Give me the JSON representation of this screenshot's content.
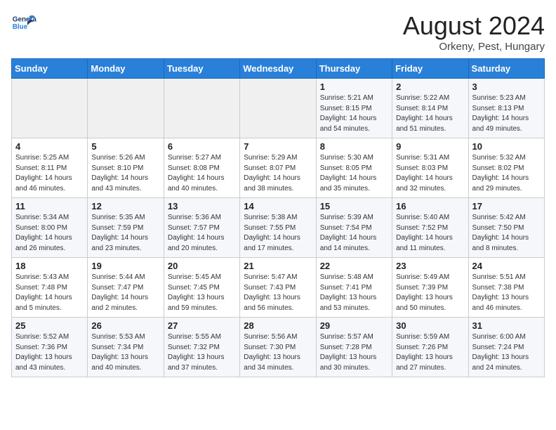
{
  "header": {
    "logo_line1": "General",
    "logo_line2": "Blue",
    "month": "August 2024",
    "location": "Orkeny, Pest, Hungary"
  },
  "days_of_week": [
    "Sunday",
    "Monday",
    "Tuesday",
    "Wednesday",
    "Thursday",
    "Friday",
    "Saturday"
  ],
  "weeks": [
    [
      {
        "day": "",
        "info": ""
      },
      {
        "day": "",
        "info": ""
      },
      {
        "day": "",
        "info": ""
      },
      {
        "day": "",
        "info": ""
      },
      {
        "day": "1",
        "info": "Sunrise: 5:21 AM\nSunset: 8:15 PM\nDaylight: 14 hours\nand 54 minutes."
      },
      {
        "day": "2",
        "info": "Sunrise: 5:22 AM\nSunset: 8:14 PM\nDaylight: 14 hours\nand 51 minutes."
      },
      {
        "day": "3",
        "info": "Sunrise: 5:23 AM\nSunset: 8:13 PM\nDaylight: 14 hours\nand 49 minutes."
      }
    ],
    [
      {
        "day": "4",
        "info": "Sunrise: 5:25 AM\nSunset: 8:11 PM\nDaylight: 14 hours\nand 46 minutes."
      },
      {
        "day": "5",
        "info": "Sunrise: 5:26 AM\nSunset: 8:10 PM\nDaylight: 14 hours\nand 43 minutes."
      },
      {
        "day": "6",
        "info": "Sunrise: 5:27 AM\nSunset: 8:08 PM\nDaylight: 14 hours\nand 40 minutes."
      },
      {
        "day": "7",
        "info": "Sunrise: 5:29 AM\nSunset: 8:07 PM\nDaylight: 14 hours\nand 38 minutes."
      },
      {
        "day": "8",
        "info": "Sunrise: 5:30 AM\nSunset: 8:05 PM\nDaylight: 14 hours\nand 35 minutes."
      },
      {
        "day": "9",
        "info": "Sunrise: 5:31 AM\nSunset: 8:03 PM\nDaylight: 14 hours\nand 32 minutes."
      },
      {
        "day": "10",
        "info": "Sunrise: 5:32 AM\nSunset: 8:02 PM\nDaylight: 14 hours\nand 29 minutes."
      }
    ],
    [
      {
        "day": "11",
        "info": "Sunrise: 5:34 AM\nSunset: 8:00 PM\nDaylight: 14 hours\nand 26 minutes."
      },
      {
        "day": "12",
        "info": "Sunrise: 5:35 AM\nSunset: 7:59 PM\nDaylight: 14 hours\nand 23 minutes."
      },
      {
        "day": "13",
        "info": "Sunrise: 5:36 AM\nSunset: 7:57 PM\nDaylight: 14 hours\nand 20 minutes."
      },
      {
        "day": "14",
        "info": "Sunrise: 5:38 AM\nSunset: 7:55 PM\nDaylight: 14 hours\nand 17 minutes."
      },
      {
        "day": "15",
        "info": "Sunrise: 5:39 AM\nSunset: 7:54 PM\nDaylight: 14 hours\nand 14 minutes."
      },
      {
        "day": "16",
        "info": "Sunrise: 5:40 AM\nSunset: 7:52 PM\nDaylight: 14 hours\nand 11 minutes."
      },
      {
        "day": "17",
        "info": "Sunrise: 5:42 AM\nSunset: 7:50 PM\nDaylight: 14 hours\nand 8 minutes."
      }
    ],
    [
      {
        "day": "18",
        "info": "Sunrise: 5:43 AM\nSunset: 7:48 PM\nDaylight: 14 hours\nand 5 minutes."
      },
      {
        "day": "19",
        "info": "Sunrise: 5:44 AM\nSunset: 7:47 PM\nDaylight: 14 hours\nand 2 minutes."
      },
      {
        "day": "20",
        "info": "Sunrise: 5:45 AM\nSunset: 7:45 PM\nDaylight: 13 hours\nand 59 minutes."
      },
      {
        "day": "21",
        "info": "Sunrise: 5:47 AM\nSunset: 7:43 PM\nDaylight: 13 hours\nand 56 minutes."
      },
      {
        "day": "22",
        "info": "Sunrise: 5:48 AM\nSunset: 7:41 PM\nDaylight: 13 hours\nand 53 minutes."
      },
      {
        "day": "23",
        "info": "Sunrise: 5:49 AM\nSunset: 7:39 PM\nDaylight: 13 hours\nand 50 minutes."
      },
      {
        "day": "24",
        "info": "Sunrise: 5:51 AM\nSunset: 7:38 PM\nDaylight: 13 hours\nand 46 minutes."
      }
    ],
    [
      {
        "day": "25",
        "info": "Sunrise: 5:52 AM\nSunset: 7:36 PM\nDaylight: 13 hours\nand 43 minutes."
      },
      {
        "day": "26",
        "info": "Sunrise: 5:53 AM\nSunset: 7:34 PM\nDaylight: 13 hours\nand 40 minutes."
      },
      {
        "day": "27",
        "info": "Sunrise: 5:55 AM\nSunset: 7:32 PM\nDaylight: 13 hours\nand 37 minutes."
      },
      {
        "day": "28",
        "info": "Sunrise: 5:56 AM\nSunset: 7:30 PM\nDaylight: 13 hours\nand 34 minutes."
      },
      {
        "day": "29",
        "info": "Sunrise: 5:57 AM\nSunset: 7:28 PM\nDaylight: 13 hours\nand 30 minutes."
      },
      {
        "day": "30",
        "info": "Sunrise: 5:59 AM\nSunset: 7:26 PM\nDaylight: 13 hours\nand 27 minutes."
      },
      {
        "day": "31",
        "info": "Sunrise: 6:00 AM\nSunset: 7:24 PM\nDaylight: 13 hours\nand 24 minutes."
      }
    ]
  ]
}
